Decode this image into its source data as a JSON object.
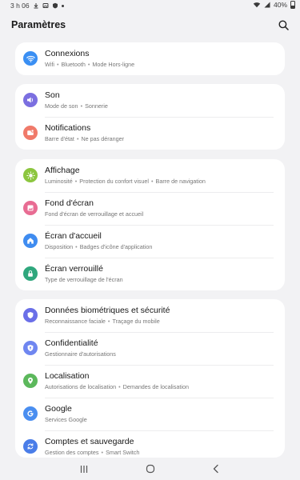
{
  "status": {
    "time": "3 h 06",
    "battery": "40%"
  },
  "header": {
    "title": "Paramètres",
    "search_icon": "search-icon"
  },
  "colors": {
    "background": "#f2f2f4",
    "card": "#ffffff",
    "connexions": "#3a8ff3",
    "son": "#7b6fe0",
    "notifications": "#f07a6a",
    "affichage": "#8cc63f",
    "fond_ecran": "#e86c93",
    "ecran_accueil": "#3f8cf0",
    "ecran_verrouille": "#2fa77d",
    "biometrie": "#6a6fe8",
    "confidentialite": "#6f86f0",
    "localisation": "#5cb85c",
    "google": "#4a8ef0",
    "comptes": "#4a7de8"
  },
  "groups": [
    {
      "items": [
        {
          "title": "Connexions",
          "subs": [
            "Wifi",
            "Bluetooth",
            "Mode Hors-ligne"
          ],
          "icon": "wifi-icon"
        }
      ]
    },
    {
      "items": [
        {
          "title": "Son",
          "subs": [
            "Mode de son",
            "Sonnerie"
          ],
          "icon": "volume-icon"
        },
        {
          "title": "Notifications",
          "subs": [
            "Barre d'état",
            "Ne pas déranger"
          ],
          "icon": "notification-icon"
        }
      ]
    },
    {
      "items": [
        {
          "title": "Affichage",
          "subs": [
            "Luminosité",
            "Protection du confort visuel",
            "Barre de navigation"
          ],
          "icon": "brightness-icon"
        },
        {
          "title": "Fond d'écran",
          "subs": [
            "Fond d'écran de verrouillage et accueil"
          ],
          "icon": "wallpaper-icon"
        },
        {
          "title": "Écran d'accueil",
          "subs": [
            "Disposition",
            "Badges d'icône d'application"
          ],
          "icon": "home-icon"
        },
        {
          "title": "Écran verrouillé",
          "subs": [
            "Type de verrouillage de l'écran"
          ],
          "icon": "lock-icon"
        }
      ]
    },
    {
      "items": [
        {
          "title": "Données biométriques et sécurité",
          "subs": [
            "Reconnaissance faciale",
            "Traçage du mobile"
          ],
          "icon": "shield-icon"
        },
        {
          "title": "Confidentialité",
          "subs": [
            "Gestionnaire d'autorisations"
          ],
          "icon": "privacy-icon"
        },
        {
          "title": "Localisation",
          "subs": [
            "Autorisations de localisation",
            "Demandes de localisation"
          ],
          "icon": "location-icon"
        },
        {
          "title": "Google",
          "subs": [
            "Services Google"
          ],
          "icon": "google-icon"
        },
        {
          "title": "Comptes et sauvegarde",
          "subs": [
            "Gestion des comptes",
            "Smart Switch"
          ],
          "icon": "sync-icon"
        }
      ]
    }
  ],
  "navbar": {
    "recents_icon": "recents-icon",
    "home_icon": "home-button-icon",
    "back_icon": "back-icon"
  }
}
